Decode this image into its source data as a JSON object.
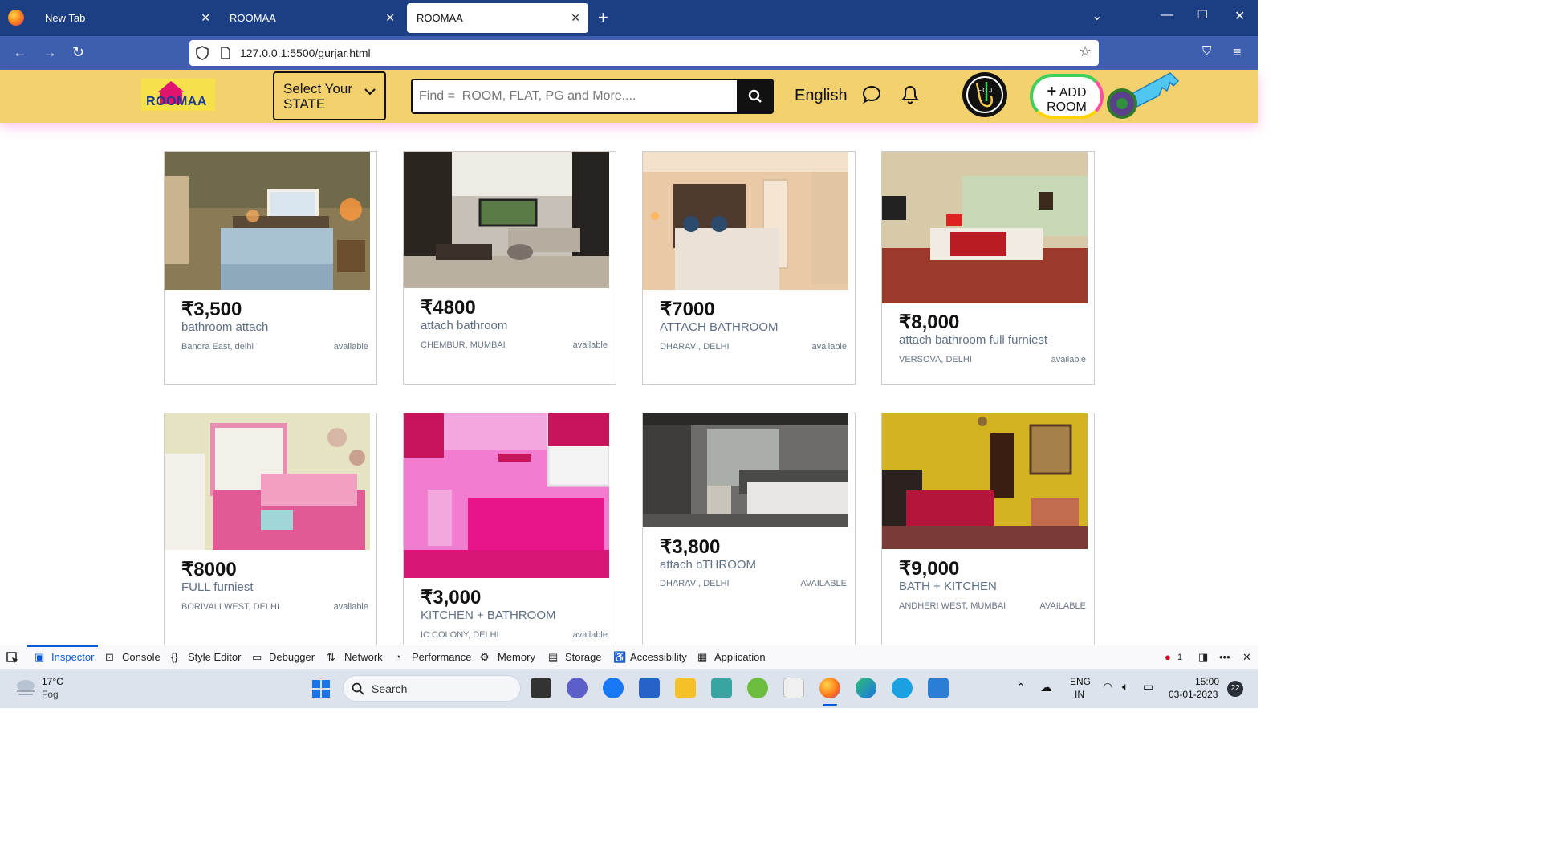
{
  "browser": {
    "tabs": [
      {
        "label": "New Tab"
      },
      {
        "label": "ROOMAA"
      },
      {
        "label": "ROOMAA"
      }
    ],
    "url": "127.0.0.1:5500/gurjar.html"
  },
  "header": {
    "logo_text": "ROOMAA",
    "state_select": {
      "line1": "Select Your",
      "line2": "STATE"
    },
    "search_placeholder": "Find =  ROOM, FLAT, PG and More....",
    "language": "English",
    "profile_text": "F.C.J.",
    "add_room": {
      "plus": "+",
      "line1": "ADD",
      "line2": "ROOM"
    }
  },
  "listings": [
    {
      "price": "₹3,500",
      "desc": "bathroom attach",
      "location": "Bandra East, delhi",
      "status": "available"
    },
    {
      "price": "₹4800",
      "desc": "attach bathroom",
      "location": "CHEMBUR, MUMBAI",
      "status": "available"
    },
    {
      "price": "₹7000",
      "desc": "ATTACH BATHROOM",
      "location": "DHARAVI, DELHI",
      "status": "available"
    },
    {
      "price": "₹8,000",
      "desc": "attach bathroom full furniest",
      "location": "VERSOVA, DELHI",
      "status": "available"
    },
    {
      "price": "₹8000",
      "desc": "FULL furniest",
      "location": "BORIVALI WEST, DELHI",
      "status": "available"
    },
    {
      "price": "₹3,000",
      "desc": "KITCHEN + BATHROOM",
      "location": "IC COLONY, DELHI",
      "status": "available"
    },
    {
      "price": "₹3,800",
      "desc": "attach bTHROOM",
      "location": "DHARAVI, DELHI",
      "status": "AVAILABLE"
    },
    {
      "price": "₹9,000",
      "desc": "BATH + KITCHEN",
      "location": "ANDHERI WEST, MUMBAI",
      "status": "AVAILABLE"
    }
  ],
  "devtools": {
    "tabs": [
      "Inspector",
      "Console",
      "Style Editor",
      "Debugger",
      "Network",
      "Performance",
      "Memory",
      "Storage",
      "Accessibility",
      "Application"
    ],
    "error_count": "1"
  },
  "taskbar": {
    "weather_temp": "17°C",
    "weather_desc": "Fog",
    "search_label": "Search",
    "lang_line1": "ENG",
    "lang_line2": "IN",
    "time": "15:00",
    "date": "03-01-2023",
    "notification_count": "22"
  }
}
